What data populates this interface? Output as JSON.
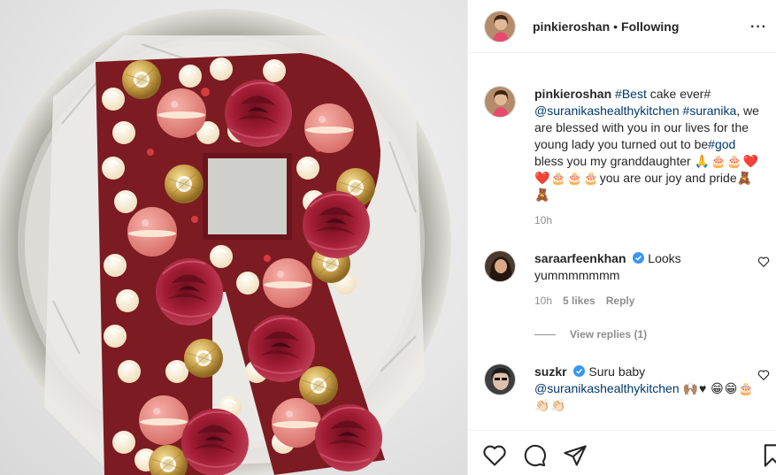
{
  "post": {
    "username": "pinkieroshan",
    "separator": "•",
    "follow_status": "Following",
    "more": "···"
  },
  "caption": {
    "username": "pinkieroshan",
    "tag_best": "#Best",
    "text1": " cake ever#",
    "mention": "@suranikashealthykitchen",
    "tag_suranika": "#suranika",
    "text2": ", we are blessed with you in our lives for the young lady you turned out to be",
    "tag_god": "#god",
    "text3": " bless you my granddaughter ",
    "emojis1": "🙏🎂🎂❤️❤️🎂🎂🎂",
    "text4": "you are our joy and pride",
    "emojis2": "🧸🧸",
    "time": "10h"
  },
  "comments": [
    {
      "username": "saraarfeenkhan",
      "text": "Looks yummmmmmm",
      "time": "10h",
      "likes": "5 likes",
      "reply": "Reply",
      "view_replies": "View replies (1)"
    },
    {
      "username": "suzkr",
      "text": "Suru baby",
      "mention": "@suranikashealthykitchen",
      "emojis": "🙌🏽♥",
      "emojis_more": "😁😁🎂👏🏻👏🏻"
    }
  ],
  "icons": {
    "verified_color": "#3897f0",
    "link_color": "#00376b",
    "meta_color": "#8e8e8e"
  }
}
